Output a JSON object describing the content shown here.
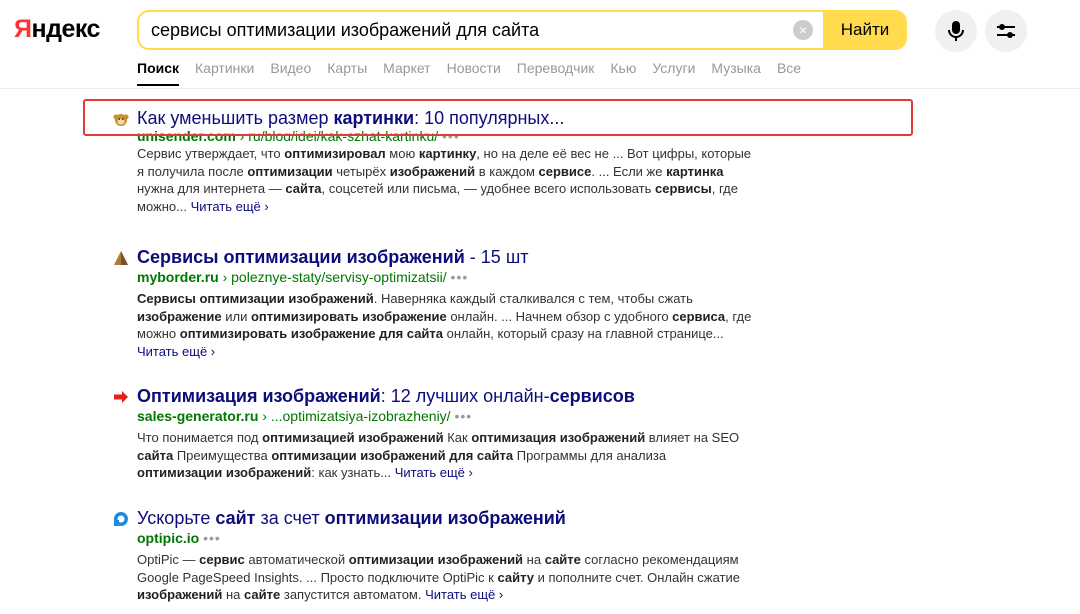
{
  "logo": {
    "first": "Я",
    "rest": "ндекс"
  },
  "search": {
    "query": "сервисы оптимизации изображений для сайта",
    "button": "Найти",
    "clear": "×"
  },
  "tabs": [
    "Поиск",
    "Картинки",
    "Видео",
    "Карты",
    "Маркет",
    "Новости",
    "Переводчик",
    "Кью",
    "Услуги",
    "Музыка",
    "Все"
  ],
  "results": [
    {
      "title_parts": [
        "Как уменьшить размер ",
        "картинки",
        ": 10 популярных..."
      ],
      "domain": "unisender.com",
      "path": "› ru/blog/idei/kak-szhat-kartinku/",
      "snippet_parts": [
        "Сервис утверждает, что ",
        "оптимизировал",
        " мою ",
        "картинку",
        ", но на деле её вес не ... Вот цифры, которые я получила после ",
        "оптимизации",
        " четырёх ",
        "изображений",
        " в каждом ",
        "сервисе",
        ". ... Если же ",
        "картинка",
        " нужна для интернета — ",
        "сайта",
        ", соцсетей или письма, — удобнее всего использовать ",
        "сервисы",
        ", где можно... "
      ],
      "readmore": "Читать ещё ›",
      "favicon": "monkey-favicon"
    },
    {
      "title_parts": [
        "Сервисы оптимизации изображений",
        " - 15 шт"
      ],
      "domain": "myborder.ru",
      "path": "› poleznye-staty/servisy-optimizatsii/",
      "snippet_parts": [
        "Сервисы оптимизации изображений",
        ". Наверняка каждый сталкивался с тем, чтобы сжать ",
        "изображение",
        " или ",
        "оптимизировать изображение",
        " онлайн. ... Начнем обзор с удобного ",
        "сервиса",
        ", где можно ",
        "оптимизировать изображение для сайта",
        " онлайн, который сразу на главной странице... "
      ],
      "readmore": "Читать ещё ›",
      "favicon": "pyramid-favicon"
    },
    {
      "title_parts": [
        "Оптимизация изображений",
        ": 12 лучших онлайн-",
        "сервисов"
      ],
      "domain": "sales-generator.ru",
      "path": "› ...optimizatsiya-izobrazheniy/",
      "snippet_parts": [
        "Что понимается под ",
        "оптимизацией изображений",
        " Как ",
        "оптимизация изображений",
        " влияет на SEO ",
        "сайта",
        " Преимущества ",
        "оптимизации изображений для сайта",
        " Программы для анализа ",
        "оптимизации изображений",
        ": как узнать... "
      ],
      "readmore": "Читать ещё ›",
      "favicon": "arrow-favicon"
    },
    {
      "title_parts": [
        "Ускорьте ",
        "сайт",
        " за счет ",
        "оптимизации изображений"
      ],
      "domain": "optipic.io",
      "path": "",
      "snippet_parts": [
        "OptiPic — ",
        "сервис",
        " автоматической ",
        "оптимизации изображений",
        " на ",
        "сайте",
        " согласно рекомендациям Google PageSpeed Insights. ... Просто подключите OptiPic к ",
        "сайту",
        " и пополните счет. Онлайн сжатие ",
        "изображений",
        " на ",
        "сайте",
        " запустится автоматом. "
      ],
      "readmore": "Читать ещё ›",
      "favicon": "optipic-favicon"
    }
  ],
  "more_dots": "•••"
}
